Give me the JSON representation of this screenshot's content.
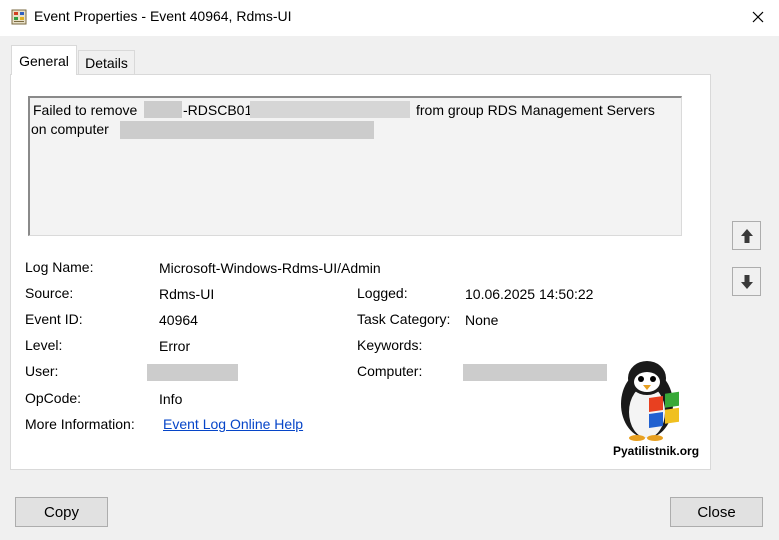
{
  "window": {
    "title": "Event Properties - Event 40964, Rdms-UI",
    "app_icon": "event-viewer-icon",
    "close_icon": "close-icon"
  },
  "tabs": [
    {
      "label": "General",
      "active": true
    },
    {
      "label": "Details",
      "active": false
    }
  ],
  "description": {
    "line1_prefix": "Failed to remove",
    "line1_fragment": "-RDSCB01",
    "line1_suffix": "from group RDS Management Servers",
    "line2_prefix": "on computer"
  },
  "fields": {
    "log_name_label": "Log Name:",
    "log_name_value": "Microsoft-Windows-Rdms-UI/Admin",
    "source_label": "Source:",
    "source_value": "Rdms-UI",
    "logged_label": "Logged:",
    "logged_value": "10.06.2025 14:50:22",
    "event_id_label": "Event ID:",
    "event_id_value": "40964",
    "task_category_label": "Task Category:",
    "task_category_value": "None",
    "level_label": "Level:",
    "level_value": "Error",
    "keywords_label": "Keywords:",
    "user_label": "User:",
    "computer_label": "Computer:",
    "opcode_label": "OpCode:",
    "opcode_value": "Info",
    "more_info_label": "More Information:",
    "more_info_link": "Event Log Online Help"
  },
  "nav": {
    "up_icon": "arrow-up-icon",
    "down_icon": "arrow-down-icon"
  },
  "buttons": {
    "copy": "Copy",
    "close": "Close"
  },
  "watermark": {
    "text": "Pyatilistnik.org"
  },
  "colors": {
    "link": "#0645c8",
    "panel": "#ffffff",
    "window_bg": "#f0f0f0"
  }
}
